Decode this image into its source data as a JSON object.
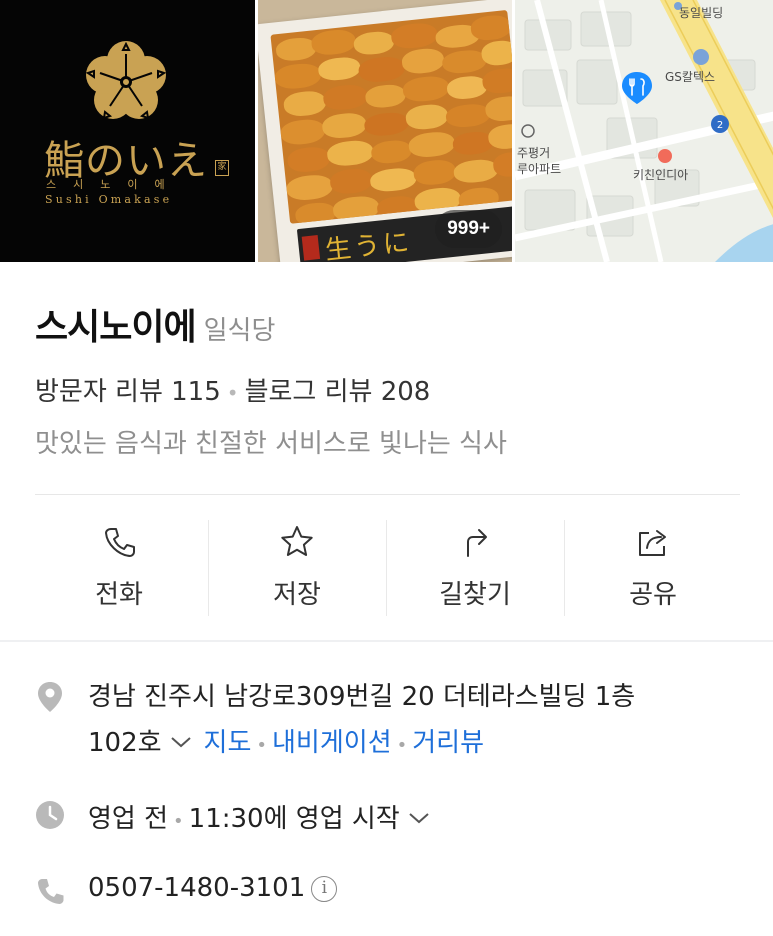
{
  "photos": {
    "logo": {
      "name_jp": "鮨のいえ",
      "seal": "家",
      "name_kr": "스시노이에",
      "name_en": "Sushi Omakase"
    },
    "count_badge": "999+",
    "map": {
      "labels": [
        "동일빌딩",
        "GS칼텍스",
        "주평거",
        "루아파트",
        "키친인디아",
        "2"
      ]
    }
  },
  "place": {
    "name": "스시노이에",
    "category": "일식당",
    "visitor_reviews": "방문자 리뷰 115",
    "blog_reviews": "블로그 리뷰 208",
    "description": "맛있는 음식과 친절한 서비스로 빛나는 식사"
  },
  "actions": [
    {
      "label": "전화",
      "icon": "phone-icon"
    },
    {
      "label": "저장",
      "icon": "star-icon"
    },
    {
      "label": "길찾기",
      "icon": "directions-icon"
    },
    {
      "label": "공유",
      "icon": "share-icon"
    }
  ],
  "details": {
    "address_line1": "경남 진주시 남강로309번길 20 더테라스빌딩 1층",
    "address_line2": "102호",
    "links": {
      "map": "지도",
      "navigation": "내비게이션",
      "street_view": "거리뷰"
    },
    "status": "영업 전",
    "hours_text": "11:30에 영업 시작",
    "phone": "0507-1480-3101"
  },
  "colors": {
    "link": "#1e6fd9",
    "logo_gold": "#c9a253",
    "pin_blue": "#1a8cff"
  }
}
